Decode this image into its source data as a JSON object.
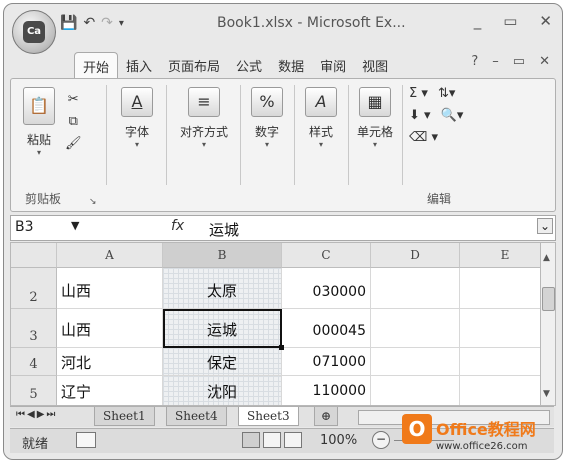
{
  "titlebar": {
    "title": "Book1.xlsx - Microsoft Ex...",
    "minimize": "_",
    "restore": "▭",
    "close": "✕",
    "office_logo": "Ca"
  },
  "tabs": [
    "开始",
    "插入",
    "页面布局",
    "公式",
    "数据",
    "审阅",
    "视图"
  ],
  "ribbon": {
    "paste": "粘贴",
    "clipboard": "剪贴板",
    "font": "字体",
    "alignment": "对齐方式",
    "number": "数字",
    "styles": "样式",
    "cells": "单元格",
    "editing": "编辑"
  },
  "formula_bar": {
    "name_box": "B3",
    "fx": "fx",
    "content": "运城"
  },
  "columns": [
    "A",
    "B",
    "C",
    "D",
    "E"
  ],
  "rows": [
    {
      "num": "2",
      "a": "山西",
      "b": "太原",
      "c": "030000"
    },
    {
      "num": "3",
      "a": "山西",
      "b": "运城",
      "c": "000045"
    },
    {
      "num": "4",
      "a": "河北",
      "b": "保定",
      "c": "071000"
    },
    {
      "num": "5",
      "a": "辽宁",
      "b": "沈阳",
      "c": "110000"
    }
  ],
  "sheets": [
    "Sheet1",
    "Sheet4",
    "Sheet3"
  ],
  "status": {
    "ready": "就绪",
    "zoom": "100%"
  },
  "watermark": {
    "logo": "O",
    "name": "Office教程网",
    "url": "www.office26.com"
  }
}
